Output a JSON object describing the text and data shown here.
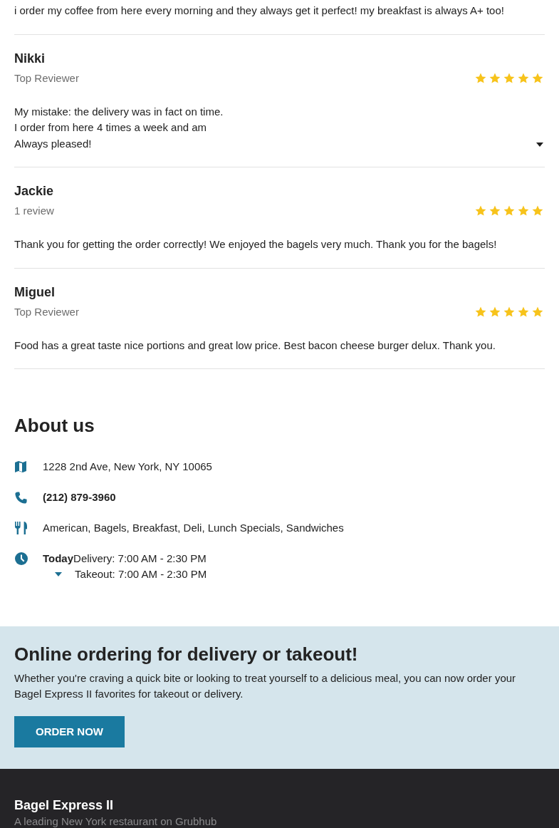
{
  "reviews": [
    {
      "body": "i order my coffee from here every morning and they always get it perfect! my breakfast is always A+ too!"
    },
    {
      "name": "Nikki",
      "subtitle": "Top Reviewer",
      "stars": 5,
      "body": "My mistake: the delivery was in fact on time.\nI order from here 4 times a week and am\nAlways pleased!",
      "expanded": false
    },
    {
      "name": "Jackie",
      "subtitle": "1 review",
      "stars": 5,
      "body": "Thank you for getting the order correctly! We enjoyed the bagels very much. Thank you for the bagels!"
    },
    {
      "name": "Miguel",
      "subtitle": "Top Reviewer",
      "stars": 5,
      "body": "Food has a great taste nice portions and great low price. Best bacon cheese burger delux. Thank you."
    }
  ],
  "about": {
    "heading": "About us",
    "items": [
      {
        "kind": "address",
        "text": "1228 2nd Ave, New York, NY 10065"
      },
      {
        "kind": "phone",
        "text": "(212) 879-3960"
      },
      {
        "kind": "cuisine",
        "text": "American, Bagels, Breakfast, Deli, Lunch Specials, Sandwiches"
      },
      {
        "kind": "hours",
        "day": "Today",
        "lines": [
          "Delivery: 7:00 AM - 2:30 PM",
          "Takeout: 7:00 AM - 2:30 PM"
        ],
        "expanded": false
      }
    ]
  },
  "promo": {
    "heading": "Online ordering for delivery or takeout!",
    "text": "Whether you're craving a quick bite or looking to treat yourself to a delicious meal, you can now order your Bagel Express II favorites for takeout or delivery.",
    "button": "ORDER NOW"
  },
  "footer": {
    "title": "Bagel Express II",
    "tagline": "A leading New York restaurant on Grubhub"
  }
}
